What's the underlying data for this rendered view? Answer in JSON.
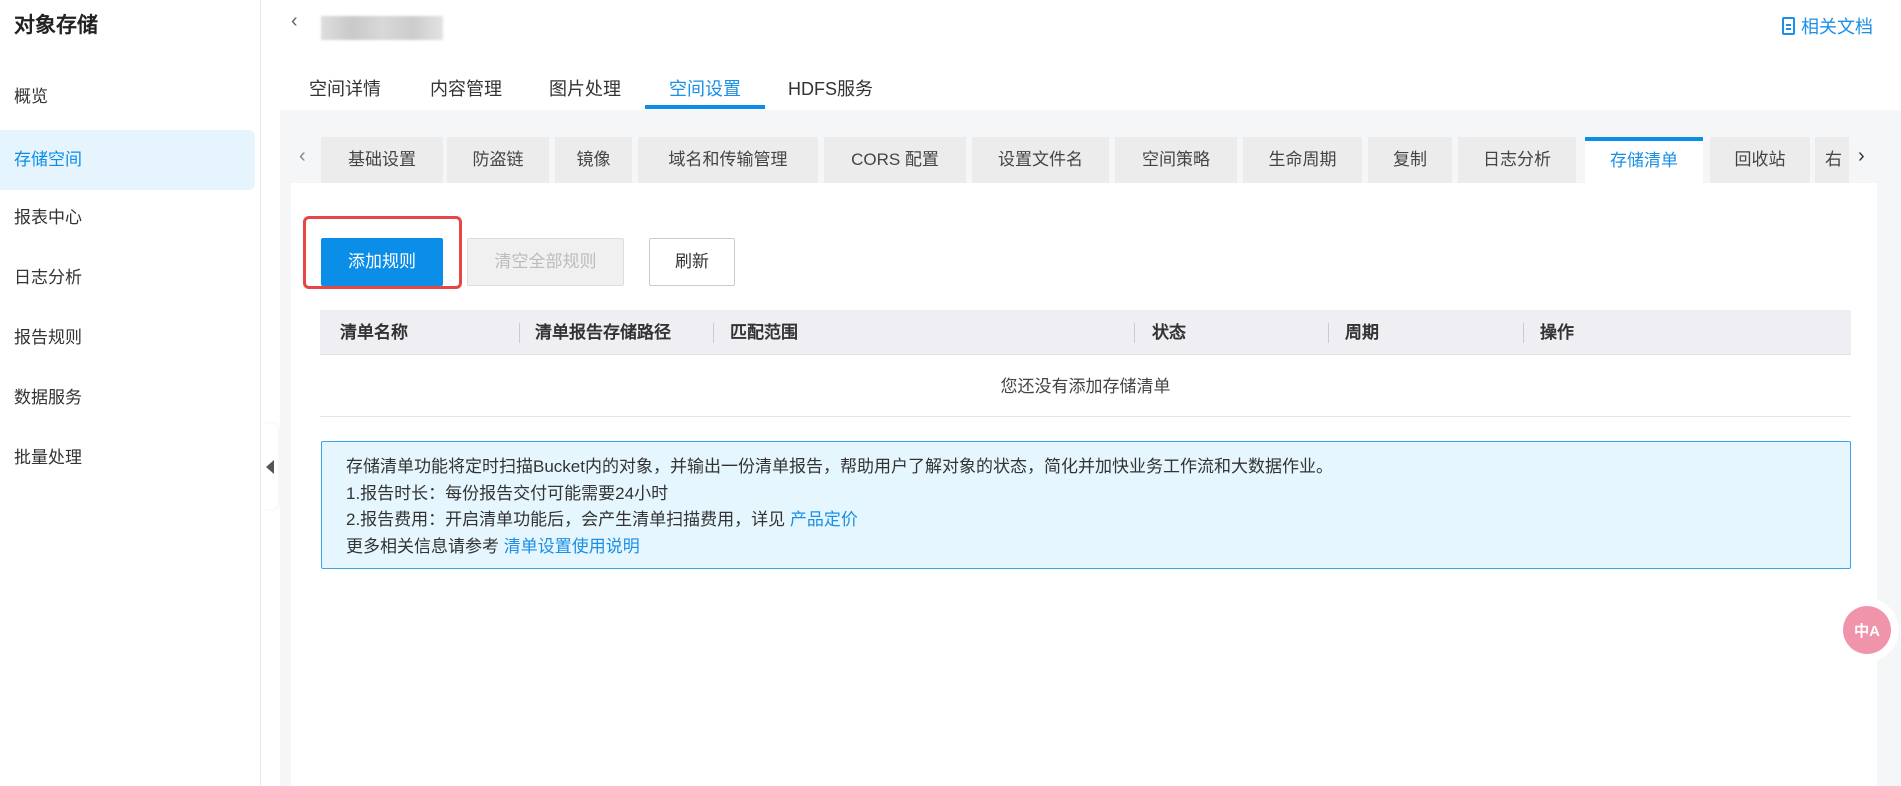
{
  "sidebar": {
    "title": "对象存储",
    "items": [
      {
        "label": "概览"
      },
      {
        "label": "存储空间",
        "active": true
      },
      {
        "label": "报表中心"
      },
      {
        "label": "日志分析"
      },
      {
        "label": "报告规则"
      },
      {
        "label": "数据服务"
      },
      {
        "label": "批量处理"
      }
    ]
  },
  "header": {
    "back_icon": "‹",
    "docs_label": "相关文档"
  },
  "top_tabs": [
    {
      "label": "空间详情"
    },
    {
      "label": "内容管理"
    },
    {
      "label": "图片处理"
    },
    {
      "label": "空间设置",
      "active": true
    },
    {
      "label": "HDFS服务"
    }
  ],
  "sub_tabs": [
    {
      "label": "基础设置"
    },
    {
      "label": "防盗链"
    },
    {
      "label": "镜像"
    },
    {
      "label": "域名和传输管理"
    },
    {
      "label": "CORS 配置"
    },
    {
      "label": "设置文件名"
    },
    {
      "label": "空间策略"
    },
    {
      "label": "生命周期"
    },
    {
      "label": "复制"
    },
    {
      "label": "日志分析"
    },
    {
      "label": "存储清单",
      "active": true
    },
    {
      "label": "回收站"
    },
    {
      "label": "右"
    }
  ],
  "toolbar": {
    "add_label": "添加规则",
    "clear_label": "清空全部规则",
    "refresh_label": "刷新"
  },
  "table": {
    "columns": [
      "清单名称",
      "清单报告存储路径",
      "匹配范围",
      "状态",
      "周期",
      "操作"
    ],
    "empty_text": "您还没有添加存储清单"
  },
  "info": {
    "line1": "存储清单功能将定时扫描Bucket内的对象，并输出一份清单报告，帮助用户了解对象的状态，简化并加快业务工作流和大数据作业。",
    "line2": "1.报告时长：每份报告交付可能需要24小时",
    "line3": "2.报告费用：开启清单功能后，会产生清单扫描费用，详见 ",
    "line3_link": "产品定价",
    "line4": "更多相关信息请参考 ",
    "line4_link": "清单设置使用说明"
  },
  "floating": {
    "translate_label": "中A"
  },
  "colors": {
    "accent": "#0a8ee8",
    "highlight": "#e84545"
  }
}
